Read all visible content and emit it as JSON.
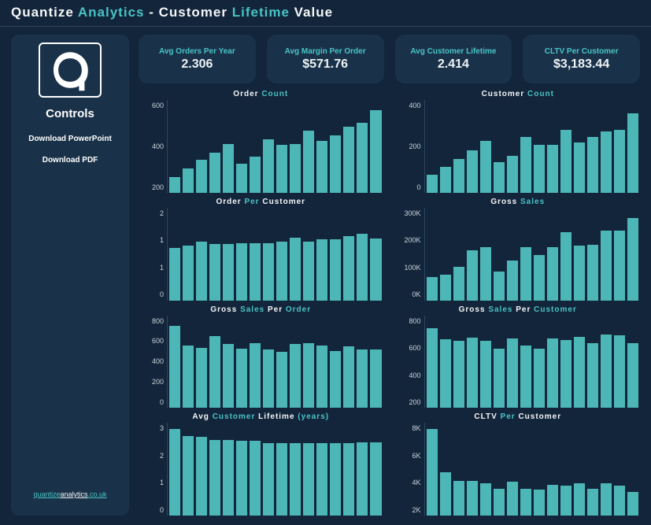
{
  "header": {
    "title_parts": [
      {
        "text": "Quantize",
        "cls": "t-white"
      },
      {
        "text": "Analytics",
        "cls": "t-teal"
      },
      {
        "text": "-",
        "cls": "t-white"
      },
      {
        "text": "Customer",
        "cls": "t-white"
      },
      {
        "text": "Lifetime",
        "cls": "t-teal"
      },
      {
        "text": "Value",
        "cls": "t-white"
      }
    ]
  },
  "sidebar": {
    "controls_label": "Controls",
    "download_ppt": "Download PowerPoint",
    "download_pdf": "Download PDF",
    "brand_1": "quantize",
    "brand_2": "analytics",
    "brand_3": ".co.uk"
  },
  "kpis": [
    {
      "label": "Avg Orders Per Year",
      "value": "2.306"
    },
    {
      "label": "Avg Margin Per Order",
      "value": "$571.76"
    },
    {
      "label": "Avg Customer Lifetime",
      "value": "2.414"
    },
    {
      "label": "CLTV Per Customer",
      "value": "$3,183.44"
    }
  ],
  "chart_data": [
    {
      "id": "order-count",
      "title_parts": [
        {
          "text": "Order",
          "cls": "t-white"
        },
        {
          "text": "Count",
          "cls": "t-teal"
        }
      ],
      "type": "bar",
      "ylim": [
        0,
        700
      ],
      "yticks": [
        "200",
        "400",
        "600"
      ],
      "values": [
        120,
        180,
        250,
        300,
        370,
        220,
        270,
        400,
        360,
        370,
        470,
        390,
        430,
        500,
        530,
        625
      ]
    },
    {
      "id": "customer-count",
      "title_parts": [
        {
          "text": "Customer",
          "cls": "t-white"
        },
        {
          "text": "Count",
          "cls": "t-teal"
        }
      ],
      "type": "bar",
      "ylim": [
        0,
        500
      ],
      "yticks": [
        "0",
        "200",
        "400"
      ],
      "values": [
        95,
        140,
        180,
        230,
        280,
        165,
        200,
        300,
        260,
        260,
        340,
        270,
        300,
        330,
        340,
        430
      ]
    },
    {
      "id": "order-per-customer",
      "title_parts": [
        {
          "text": "Order",
          "cls": "t-white"
        },
        {
          "text": "Per",
          "cls": "t-teal"
        },
        {
          "text": "Customer",
          "cls": "t-white"
        }
      ],
      "type": "bar",
      "ylim": [
        0,
        2.2
      ],
      "yticks": [
        "0",
        "1",
        "1",
        "2"
      ],
      "values": [
        1.25,
        1.3,
        1.4,
        1.33,
        1.33,
        1.35,
        1.35,
        1.35,
        1.4,
        1.48,
        1.4,
        1.45,
        1.45,
        1.53,
        1.58,
        1.47
      ]
    },
    {
      "id": "gross-sales",
      "title_parts": [
        {
          "text": "Gross",
          "cls": "t-white"
        },
        {
          "text": "Sales",
          "cls": "t-teal"
        }
      ],
      "type": "bar",
      "ylim": [
        0,
        400000
      ],
      "yticks": [
        "0K",
        "100K",
        "200K",
        "300K"
      ],
      "values": [
        100000,
        110000,
        145000,
        215000,
        230000,
        125000,
        170000,
        230000,
        195000,
        230000,
        295000,
        235000,
        240000,
        300000,
        300000,
        355000
      ]
    },
    {
      "id": "gross-sales-per-order",
      "title_parts": [
        {
          "text": "Gross",
          "cls": "t-white"
        },
        {
          "text": "Sales",
          "cls": "t-teal"
        },
        {
          "text": "Per",
          "cls": "t-white"
        },
        {
          "text": "Order",
          "cls": "t-teal"
        }
      ],
      "type": "bar",
      "ylim": [
        0,
        900
      ],
      "yticks": [
        "0",
        "200",
        "400",
        "600",
        "800"
      ],
      "values": [
        800,
        605,
        580,
        700,
        620,
        575,
        625,
        570,
        545,
        620,
        627,
        605,
        555,
        600,
        570,
        565
      ]
    },
    {
      "id": "gross-sales-per-customer",
      "title_parts": [
        {
          "text": "Gross",
          "cls": "t-white"
        },
        {
          "text": "Sales",
          "cls": "t-teal"
        },
        {
          "text": "Per",
          "cls": "t-white"
        },
        {
          "text": "Customer",
          "cls": "t-teal"
        }
      ],
      "type": "bar",
      "ylim": [
        0,
        1000
      ],
      "yticks": [
        "200",
        "400",
        "600",
        "800"
      ],
      "values": [
        860,
        740,
        720,
        760,
        720,
        640,
        750,
        670,
        640,
        750,
        730,
        770,
        700,
        790,
        780,
        700
      ]
    },
    {
      "id": "avg-customer-lifetime",
      "title_parts": [
        {
          "text": "Avg",
          "cls": "t-white"
        },
        {
          "text": "Customer",
          "cls": "t-teal"
        },
        {
          "text": "Lifetime",
          "cls": "t-white"
        },
        {
          "text": "(years)",
          "cls": "t-teal"
        }
      ],
      "type": "bar",
      "ylim": [
        0,
        3.6
      ],
      "yticks": [
        "0",
        "1",
        "2",
        "3"
      ],
      "values": [
        3.35,
        3.1,
        3.05,
        2.95,
        2.95,
        2.9,
        2.9,
        2.8,
        2.8,
        2.8,
        2.8,
        2.8,
        2.8,
        2.8,
        2.85,
        2.85
      ]
    },
    {
      "id": "cltv-per-customer",
      "title_parts": [
        {
          "text": "CLTV",
          "cls": "t-white"
        },
        {
          "text": "Per",
          "cls": "t-teal"
        },
        {
          "text": "Customer",
          "cls": "t-white"
        }
      ],
      "type": "bar",
      "ylim": [
        0,
        9000
      ],
      "yticks": [
        "2K",
        "4K",
        "6K",
        "8K"
      ],
      "values": [
        8400,
        4200,
        3400,
        3400,
        3100,
        2600,
        3300,
        2600,
        2500,
        3000,
        2900,
        3100,
        2600,
        3100,
        2900,
        2300
      ]
    }
  ]
}
